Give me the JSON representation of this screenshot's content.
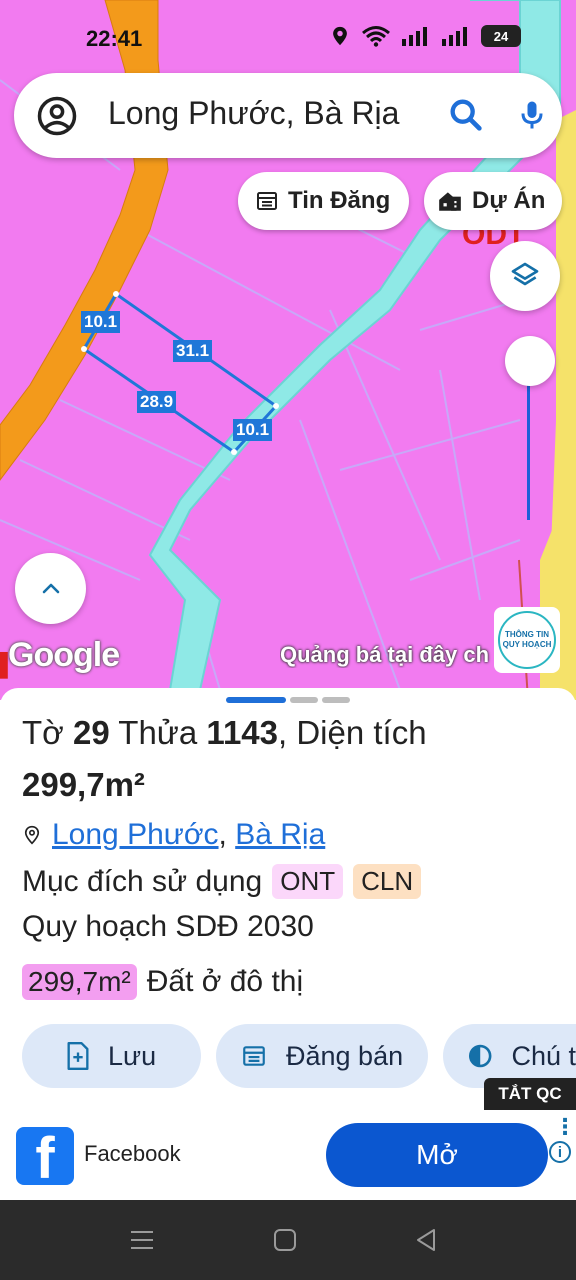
{
  "status_bar": {
    "time": "22:41",
    "battery": "24"
  },
  "search": {
    "query": "Long Phước, Bà Rịa"
  },
  "chips": {
    "listing": "Tin Đăng",
    "project": "Dự Án"
  },
  "map": {
    "dimensions": [
      "10.1",
      "31.1",
      "28.9",
      "10.1"
    ],
    "google_logo": "Google",
    "ad_text": "Quảng bá tại đây ch",
    "info_badge": [
      "THÔNG TIN",
      "QUY HOẠCH"
    ]
  },
  "parcel": {
    "sheet_label": "Tờ",
    "sheet_no": "29",
    "lot_label": "Thửa",
    "lot_no": "1143",
    "area_label": ", Diện tích",
    "area": "299,7m²",
    "ward": "Long Phước",
    "district": "Bà Rịa",
    "usage_label": "Mục đích sử dụng",
    "usage_tags": [
      "ONT",
      "CLN"
    ],
    "plan_label": "Quy hoạch SDĐ 2030",
    "plan_area": "299,7m²",
    "plan_type": "Đất ở đô thị"
  },
  "actions": {
    "save": "Lưu",
    "post": "Đăng bán",
    "note": "Chú t"
  },
  "ad": {
    "hide_label": "TẮT QC",
    "app_name": "Facebook",
    "open_label": "Mở"
  },
  "colors": {
    "map_pink": "#f27bf0",
    "road_orange": "#f39a1b",
    "river_cyan": "#8fe9e6",
    "accent_blue": "#1f6fd8"
  }
}
